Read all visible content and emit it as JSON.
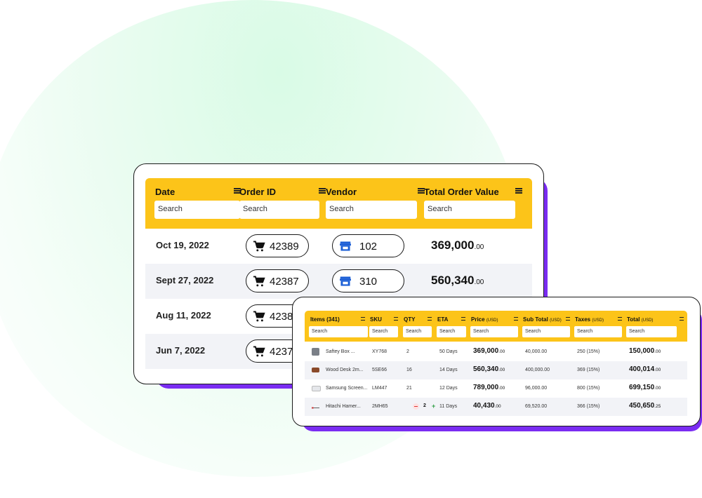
{
  "orders_table": {
    "columns": [
      {
        "label": "Date",
        "search_placeholder": "Search"
      },
      {
        "label": "Order ID",
        "search_placeholder": "Search"
      },
      {
        "label": "Vendor",
        "search_placeholder": "Search"
      },
      {
        "label": "Total Order Value",
        "search_placeholder": "Search"
      }
    ],
    "rows": [
      {
        "date": "Oct 19, 2022",
        "order_id": "42389",
        "vendor": "102",
        "value_main": "369,000",
        "value_cents": ".00"
      },
      {
        "date": "Sept 27, 2022",
        "order_id": "42387",
        "vendor": "310",
        "value_main": "560,340",
        "value_cents": ".00"
      },
      {
        "date": "Aug 11, 2022",
        "order_id": "4238",
        "vendor": "",
        "value_main": "",
        "value_cents": ""
      },
      {
        "date": "Jun 7, 2022",
        "order_id": "4237",
        "vendor": "",
        "value_main": "",
        "value_cents": ""
      }
    ]
  },
  "items_table": {
    "columns": [
      {
        "label": "Items (341)",
        "unit": "",
        "search_placeholder": "Search"
      },
      {
        "label": "SKU",
        "unit": "",
        "search_placeholder": "Search"
      },
      {
        "label": "QTY",
        "unit": "",
        "search_placeholder": "Search"
      },
      {
        "label": "ETA",
        "unit": "",
        "search_placeholder": "Search"
      },
      {
        "label": "Price",
        "unit": "(USD)",
        "search_placeholder": "Search"
      },
      {
        "label": "Sub Total",
        "unit": "(USD)",
        "search_placeholder": "Search"
      },
      {
        "label": "Taxes",
        "unit": "(USD)",
        "search_placeholder": "Search"
      },
      {
        "label": "Total",
        "unit": "(USD)",
        "search_placeholder": "Search"
      }
    ],
    "rows": [
      {
        "item": "Saftey Box ...",
        "sku": "XY768",
        "qty": "2",
        "eta": "50 Days",
        "price_main": "369,000",
        "price_cents": ".00",
        "subtotal": "40,000.00",
        "taxes": "250 (15%)",
        "total_main": "150,000",
        "total_cents": ".00"
      },
      {
        "item": "Wood Desk 2m...",
        "sku": "5SE66",
        "qty": "16",
        "eta": "14 Days",
        "price_main": "560,340",
        "price_cents": ".00",
        "subtotal": "400,000.00",
        "taxes": "369 (15%)",
        "total_main": "400,014",
        "total_cents": ".00"
      },
      {
        "item": "Samsung Screen...",
        "sku": "LM447",
        "qty": "21",
        "eta": "12 Days",
        "price_main": "789,000",
        "price_cents": ".00",
        "subtotal": "96,000.00",
        "taxes": "800 (15%)",
        "total_main": "699,150",
        "total_cents": ".00"
      },
      {
        "item": "Hitachi Hamer...",
        "sku": "2MH65",
        "qty": "2",
        "eta": "11 Days",
        "price_main": "40,430",
        "price_cents": ".00",
        "subtotal": "69,520.00",
        "taxes": "366 (15%)",
        "total_main": "450,650",
        "total_cents": ".25"
      }
    ]
  },
  "colors": {
    "header": "#fcc419",
    "accent_shadow": "#7a2cf2",
    "vendor_icon": "#1c5fd6"
  }
}
